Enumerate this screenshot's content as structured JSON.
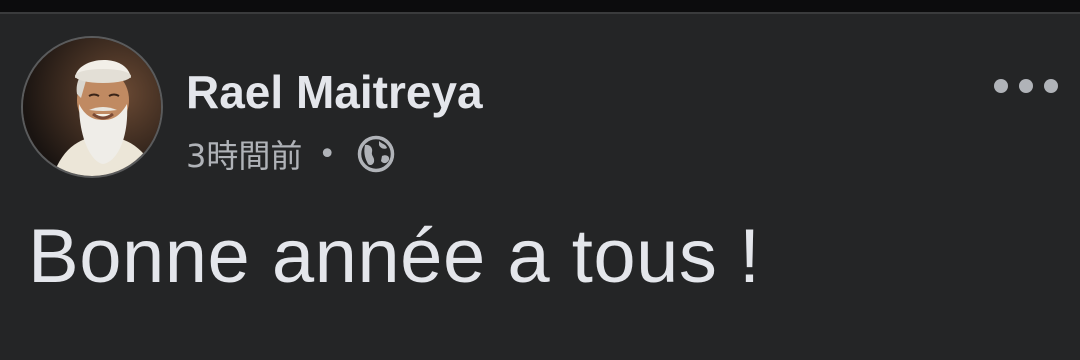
{
  "post": {
    "author": {
      "name": "Rael Maitreya",
      "avatar": "profile-photo"
    },
    "timestamp": "3時間前",
    "separator": "•",
    "audience_icon": "globe-icon",
    "more_icon": "more-options-icon",
    "text": "Bonne année a tous !"
  },
  "colors": {
    "background": "#242526",
    "primary_text": "#e4e6eb",
    "secondary_text": "#b0b3b8"
  }
}
